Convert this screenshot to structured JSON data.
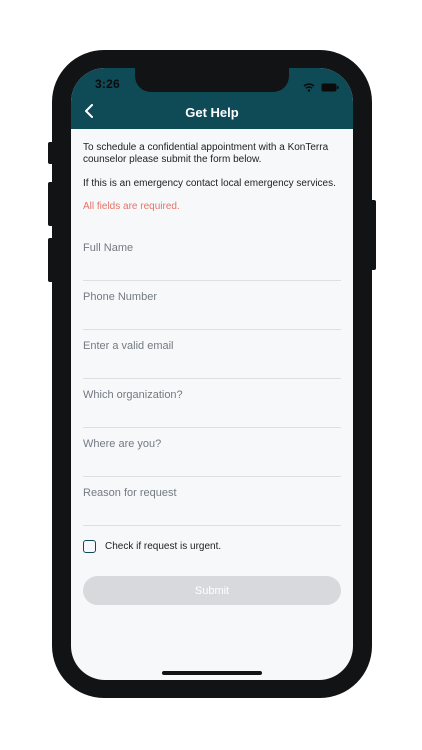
{
  "status_bar": {
    "time": "3:26"
  },
  "header": {
    "title": "Get Help",
    "back_icon": "chevron-left-icon",
    "background_color": "#0f4a57"
  },
  "intro": {
    "line1": "To schedule a confidential appointment with a KonTerra counselor please submit the form below.",
    "line2": "If this is an emergency contact local emergency services.",
    "required_note": "All fields are required."
  },
  "form": {
    "fields": [
      {
        "placeholder": "Full Name",
        "value": ""
      },
      {
        "placeholder": "Phone Number",
        "value": ""
      },
      {
        "placeholder": "Enter a valid email",
        "value": ""
      },
      {
        "placeholder": "Which organization?",
        "value": ""
      },
      {
        "placeholder": "Where are you?",
        "value": ""
      },
      {
        "placeholder": "Reason for request",
        "value": ""
      }
    ],
    "urgent_label": "Check if request is urgent.",
    "urgent_checked": false,
    "submit_label": "Submit"
  },
  "colors": {
    "accent": "#0f4a57",
    "required_text": "#e57368",
    "submit_disabled": "#d7d9dc"
  }
}
